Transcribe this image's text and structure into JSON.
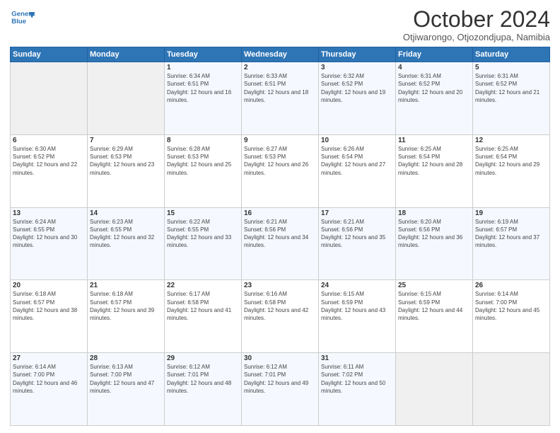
{
  "header": {
    "logo_line1": "General",
    "logo_line2": "Blue",
    "month": "October 2024",
    "location": "Otjiwarongo, Otjozondjupa, Namibia"
  },
  "weekdays": [
    "Sunday",
    "Monday",
    "Tuesday",
    "Wednesday",
    "Thursday",
    "Friday",
    "Saturday"
  ],
  "weeks": [
    [
      {
        "day": "",
        "sunrise": "",
        "sunset": "",
        "daylight": ""
      },
      {
        "day": "",
        "sunrise": "",
        "sunset": "",
        "daylight": ""
      },
      {
        "day": "1",
        "sunrise": "Sunrise: 6:34 AM",
        "sunset": "Sunset: 6:51 PM",
        "daylight": "Daylight: 12 hours and 16 minutes."
      },
      {
        "day": "2",
        "sunrise": "Sunrise: 6:33 AM",
        "sunset": "Sunset: 6:51 PM",
        "daylight": "Daylight: 12 hours and 18 minutes."
      },
      {
        "day": "3",
        "sunrise": "Sunrise: 6:32 AM",
        "sunset": "Sunset: 6:52 PM",
        "daylight": "Daylight: 12 hours and 19 minutes."
      },
      {
        "day": "4",
        "sunrise": "Sunrise: 6:31 AM",
        "sunset": "Sunset: 6:52 PM",
        "daylight": "Daylight: 12 hours and 20 minutes."
      },
      {
        "day": "5",
        "sunrise": "Sunrise: 6:31 AM",
        "sunset": "Sunset: 6:52 PM",
        "daylight": "Daylight: 12 hours and 21 minutes."
      }
    ],
    [
      {
        "day": "6",
        "sunrise": "Sunrise: 6:30 AM",
        "sunset": "Sunset: 6:52 PM",
        "daylight": "Daylight: 12 hours and 22 minutes."
      },
      {
        "day": "7",
        "sunrise": "Sunrise: 6:29 AM",
        "sunset": "Sunset: 6:53 PM",
        "daylight": "Daylight: 12 hours and 23 minutes."
      },
      {
        "day": "8",
        "sunrise": "Sunrise: 6:28 AM",
        "sunset": "Sunset: 6:53 PM",
        "daylight": "Daylight: 12 hours and 25 minutes."
      },
      {
        "day": "9",
        "sunrise": "Sunrise: 6:27 AM",
        "sunset": "Sunset: 6:53 PM",
        "daylight": "Daylight: 12 hours and 26 minutes."
      },
      {
        "day": "10",
        "sunrise": "Sunrise: 6:26 AM",
        "sunset": "Sunset: 6:54 PM",
        "daylight": "Daylight: 12 hours and 27 minutes."
      },
      {
        "day": "11",
        "sunrise": "Sunrise: 6:25 AM",
        "sunset": "Sunset: 6:54 PM",
        "daylight": "Daylight: 12 hours and 28 minutes."
      },
      {
        "day": "12",
        "sunrise": "Sunrise: 6:25 AM",
        "sunset": "Sunset: 6:54 PM",
        "daylight": "Daylight: 12 hours and 29 minutes."
      }
    ],
    [
      {
        "day": "13",
        "sunrise": "Sunrise: 6:24 AM",
        "sunset": "Sunset: 6:55 PM",
        "daylight": "Daylight: 12 hours and 30 minutes."
      },
      {
        "day": "14",
        "sunrise": "Sunrise: 6:23 AM",
        "sunset": "Sunset: 6:55 PM",
        "daylight": "Daylight: 12 hours and 32 minutes."
      },
      {
        "day": "15",
        "sunrise": "Sunrise: 6:22 AM",
        "sunset": "Sunset: 6:55 PM",
        "daylight": "Daylight: 12 hours and 33 minutes."
      },
      {
        "day": "16",
        "sunrise": "Sunrise: 6:21 AM",
        "sunset": "Sunset: 6:56 PM",
        "daylight": "Daylight: 12 hours and 34 minutes."
      },
      {
        "day": "17",
        "sunrise": "Sunrise: 6:21 AM",
        "sunset": "Sunset: 6:56 PM",
        "daylight": "Daylight: 12 hours and 35 minutes."
      },
      {
        "day": "18",
        "sunrise": "Sunrise: 6:20 AM",
        "sunset": "Sunset: 6:56 PM",
        "daylight": "Daylight: 12 hours and 36 minutes."
      },
      {
        "day": "19",
        "sunrise": "Sunrise: 6:19 AM",
        "sunset": "Sunset: 6:57 PM",
        "daylight": "Daylight: 12 hours and 37 minutes."
      }
    ],
    [
      {
        "day": "20",
        "sunrise": "Sunrise: 6:18 AM",
        "sunset": "Sunset: 6:57 PM",
        "daylight": "Daylight: 12 hours and 38 minutes."
      },
      {
        "day": "21",
        "sunrise": "Sunrise: 6:18 AM",
        "sunset": "Sunset: 6:57 PM",
        "daylight": "Daylight: 12 hours and 39 minutes."
      },
      {
        "day": "22",
        "sunrise": "Sunrise: 6:17 AM",
        "sunset": "Sunset: 6:58 PM",
        "daylight": "Daylight: 12 hours and 41 minutes."
      },
      {
        "day": "23",
        "sunrise": "Sunrise: 6:16 AM",
        "sunset": "Sunset: 6:58 PM",
        "daylight": "Daylight: 12 hours and 42 minutes."
      },
      {
        "day": "24",
        "sunrise": "Sunrise: 6:15 AM",
        "sunset": "Sunset: 6:59 PM",
        "daylight": "Daylight: 12 hours and 43 minutes."
      },
      {
        "day": "25",
        "sunrise": "Sunrise: 6:15 AM",
        "sunset": "Sunset: 6:59 PM",
        "daylight": "Daylight: 12 hours and 44 minutes."
      },
      {
        "day": "26",
        "sunrise": "Sunrise: 6:14 AM",
        "sunset": "Sunset: 7:00 PM",
        "daylight": "Daylight: 12 hours and 45 minutes."
      }
    ],
    [
      {
        "day": "27",
        "sunrise": "Sunrise: 6:14 AM",
        "sunset": "Sunset: 7:00 PM",
        "daylight": "Daylight: 12 hours and 46 minutes."
      },
      {
        "day": "28",
        "sunrise": "Sunrise: 6:13 AM",
        "sunset": "Sunset: 7:00 PM",
        "daylight": "Daylight: 12 hours and 47 minutes."
      },
      {
        "day": "29",
        "sunrise": "Sunrise: 6:12 AM",
        "sunset": "Sunset: 7:01 PM",
        "daylight": "Daylight: 12 hours and 48 minutes."
      },
      {
        "day": "30",
        "sunrise": "Sunrise: 6:12 AM",
        "sunset": "Sunset: 7:01 PM",
        "daylight": "Daylight: 12 hours and 49 minutes."
      },
      {
        "day": "31",
        "sunrise": "Sunrise: 6:11 AM",
        "sunset": "Sunset: 7:02 PM",
        "daylight": "Daylight: 12 hours and 50 minutes."
      },
      {
        "day": "",
        "sunrise": "",
        "sunset": "",
        "daylight": ""
      },
      {
        "day": "",
        "sunrise": "",
        "sunset": "",
        "daylight": ""
      }
    ]
  ]
}
